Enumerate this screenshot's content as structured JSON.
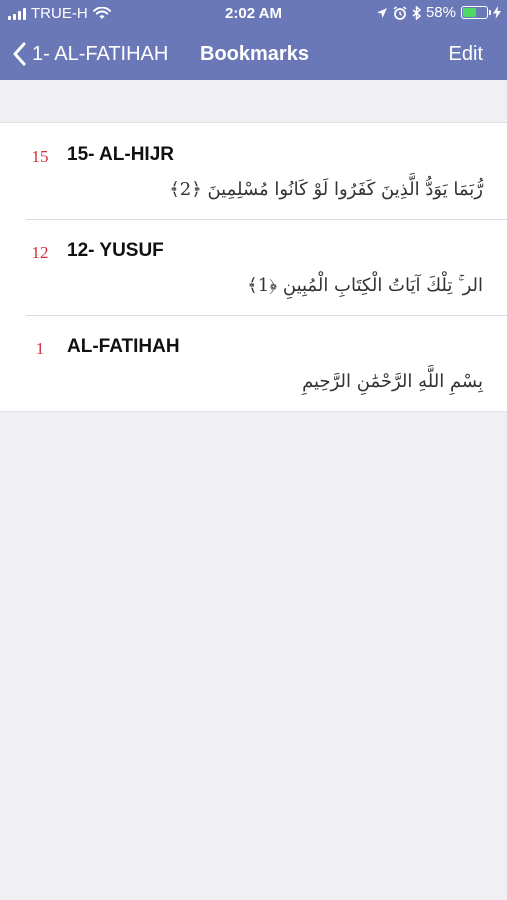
{
  "status": {
    "carrier": "TRUE-H",
    "time": "2:02 AM",
    "battery_percent": "58%",
    "battery_level": 0.58,
    "icons": [
      "signal-icon",
      "wifi-icon",
      "location-icon",
      "alarm-icon",
      "bluetooth-icon",
      "battery-icon",
      "charging-icon"
    ]
  },
  "nav": {
    "back_label": "1- AL-FATIHAH",
    "title": "Bookmarks",
    "edit_label": "Edit"
  },
  "colors": {
    "nav_background": "#6a78b7",
    "page_number": "#d0303a",
    "page_background": "#efeff4"
  },
  "bookmarks": [
    {
      "page": "15",
      "surah": "15- AL-HIJR",
      "verse": "رُّبَمَا يَوَدُّ الَّذِينَ كَفَرُوا لَوْ كَانُوا مُسْلِمِينَ ﴿2﴾"
    },
    {
      "page": "12",
      "surah": "12- YUSUF",
      "verse": "الر ۚ تِلْكَ آيَاتُ الْكِتَابِ الْمُبِينِ ﴿1﴾"
    },
    {
      "page": "1",
      "surah": "AL-FATIHAH",
      "verse": "بِسْمِ اللَّهِ الرَّحْمَٰنِ الرَّحِيمِ"
    }
  ]
}
